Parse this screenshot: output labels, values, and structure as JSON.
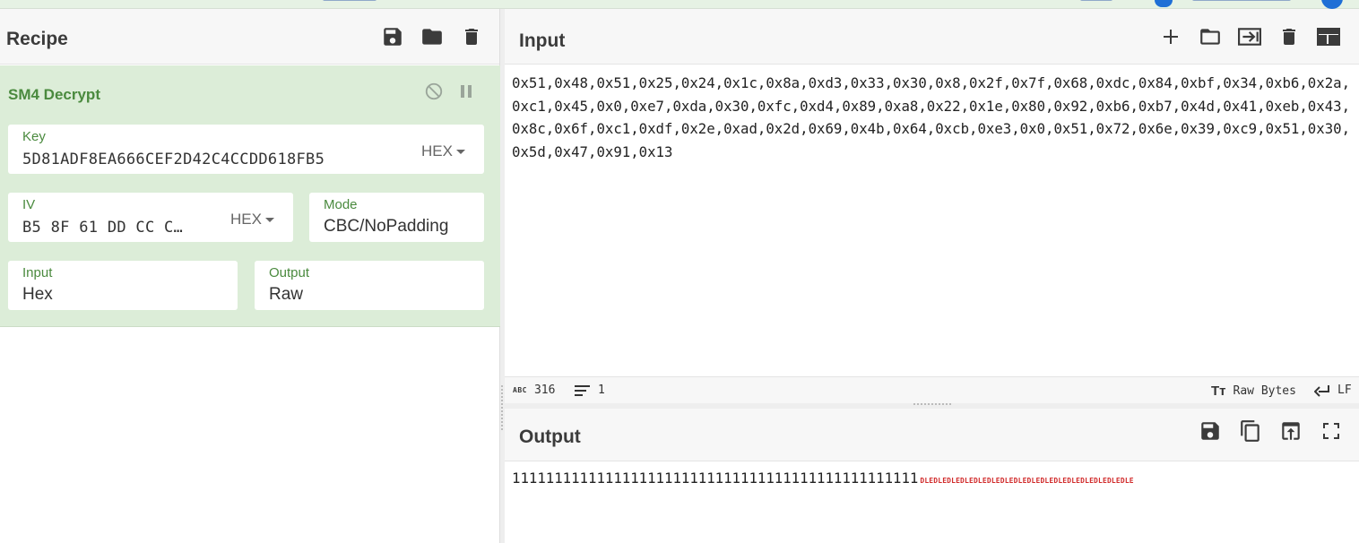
{
  "recipe": {
    "title": "Recipe",
    "operation": {
      "title": "SM4 Decrypt",
      "key": {
        "label": "Key",
        "value": "5D81ADF8EA666CEF2D42C4CCDD618FB5",
        "format": "HEX"
      },
      "iv": {
        "label": "IV",
        "value": "B5 8F 61 DD CC C…",
        "format": "HEX"
      },
      "mode": {
        "label": "Mode",
        "value": "CBC/NoPadding"
      },
      "input": {
        "label": "Input",
        "value": "Hex"
      },
      "output": {
        "label": "Output",
        "value": "Raw"
      }
    }
  },
  "input": {
    "title": "Input",
    "text": "0x51,0x48,0x51,0x25,0x24,0x1c,0x8a,0xd3,0x33,0x30,0x8,0x2f,0x7f,0x68,0xdc,0x84,0xbf,0x34,0xb6,0x2a,0xc1,0x45,0x0,0xe7,0xda,0x30,0xfc,0xd4,0x89,0xa8,0x22,0x1e,0x80,0x92,0xb6,0xb7,0x4d,0x41,0xeb,0x43,0x8c,0x6f,0xc1,0xdf,0x2e,0xad,0x2d,0x69,0x4b,0x64,0xcb,0xe3,0x0,0x51,0x72,0x6e,0x39,0xc9,0x51,0x30,0x5d,0x47,0x91,0x13",
    "status": {
      "abc_icon": "ABC",
      "length": "316",
      "lines": "1",
      "encoding": "Raw Bytes",
      "eol": "LF"
    }
  },
  "output": {
    "title": "Output",
    "text": "111111111111111111111111111111111111111111111111",
    "control_chars": "DLEDLEDLEDLEDLEDLEDLEDLEDLEDLEDLEDLEDLEDLEDLEDLE"
  },
  "colors": {
    "op_bg": "#dcedd8",
    "op_title": "#4a8a3e",
    "ctrl_red": "#d12b2b"
  }
}
